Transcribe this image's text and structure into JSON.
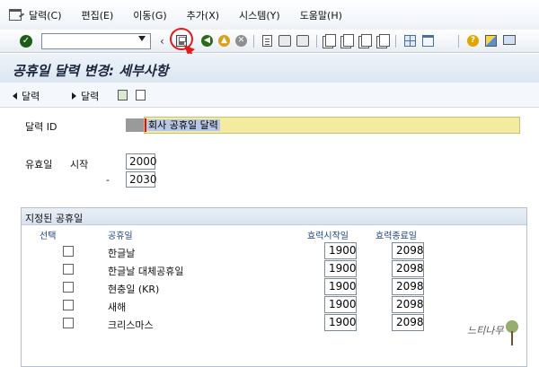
{
  "menu": {
    "items": [
      "달력(C)",
      "편집(E)",
      "이동(G)",
      "추가(X)",
      "시스템(Y)",
      "도움말(H)"
    ]
  },
  "toolbar": {
    "command_field_value": "",
    "icons": [
      "check-icon",
      "dropdown-icon",
      "back-chevron-icon",
      "save-icon",
      "back-icon",
      "exit-icon",
      "cancel-icon",
      "print-icon",
      "find-icon",
      "find-next-icon",
      "first-page-icon",
      "prev-page-icon",
      "next-page-icon",
      "last-page-icon",
      "new-session-icon",
      "shortcut-icon",
      "help-icon",
      "layout-icon",
      "monitor-icon"
    ]
  },
  "page": {
    "title": "공휴일 달력 변경: 세부사항"
  },
  "app_toolbar": {
    "prev_label": "달력",
    "next_label": "달력"
  },
  "form": {
    "calendar_id_label": "달력 ID",
    "calendar_id_value": "회사 공휴일 달력",
    "validity_label": "유효일",
    "start_label": "시작",
    "end_separator": "-",
    "valid_from": "2000",
    "valid_to": "2030"
  },
  "holidays": {
    "title": "지정된 공휴일",
    "columns": {
      "select": "선택",
      "holiday": "공휴일",
      "valid_from": "효력시작일",
      "valid_to": "효력종료일"
    },
    "rows": [
      {
        "name": "한글날",
        "from": "1900",
        "to": "2098",
        "selected": false
      },
      {
        "name": "한글날 대체공휴일",
        "from": "1900",
        "to": "2098",
        "selected": false
      },
      {
        "name": "현충일 (KR)",
        "from": "1900",
        "to": "2098",
        "selected": false
      },
      {
        "name": "새해",
        "from": "1900",
        "to": "2098",
        "selected": false
      },
      {
        "name": "크리스마스",
        "from": "1900",
        "to": "2098",
        "selected": false
      }
    ]
  },
  "watermark": "느티나무",
  "colors": {
    "highlight_field": "#f3eca0",
    "annotation": "#e21a1a",
    "title_bg": "#dce6f1"
  }
}
